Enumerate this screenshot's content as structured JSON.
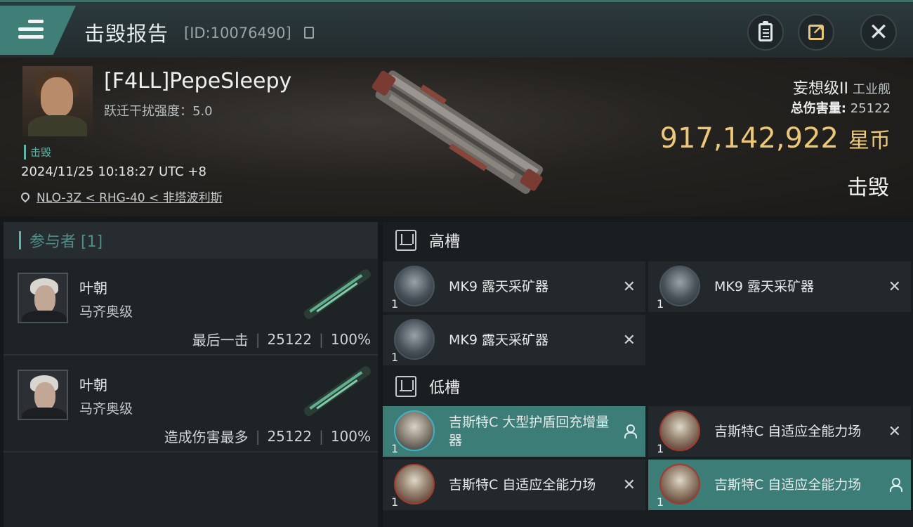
{
  "header": {
    "title": "击毁报告",
    "report_id": "[ID:10076490]"
  },
  "victim": {
    "pilot": "[F4LL]PepeSleepy",
    "scram_strength": "跃迁干扰强度：5.0",
    "tag": "击毁",
    "time": "2024/11/25 10:18:27 UTC +8",
    "location": "NLO-3Z < RHG-40 < 非塔波利斯",
    "ship": "妄想级II",
    "ship_class": "工业舰",
    "total_damage_label": "总伤害量:",
    "total_damage": "25122",
    "isk_value": "917,142,922",
    "isk_unit": "星币",
    "status": "击毁"
  },
  "participants": {
    "header": "参与者 [1]",
    "rows": [
      {
        "name": "叶朝",
        "ship": "马齐奥级",
        "label": "最后一击",
        "damage": "25122",
        "percent": "100%"
      },
      {
        "name": "叶朝",
        "ship": "马齐奥级",
        "label": "造成伤害最多",
        "damage": "25122",
        "percent": "100%"
      }
    ]
  },
  "fitting": {
    "high_slot_label": "高槽",
    "low_slot_label": "低槽",
    "high": [
      {
        "name": "MK9 露天采矿器",
        "qty": "1",
        "state": "destroyed"
      },
      {
        "name": "MK9 露天采矿器",
        "qty": "1",
        "state": "destroyed"
      },
      {
        "name": "MK9 露天采矿器",
        "qty": "1",
        "state": "destroyed"
      }
    ],
    "low": [
      {
        "name": "吉斯特C 大型护盾回充增量器",
        "qty": "1",
        "state": "dropped"
      },
      {
        "name": "吉斯特C 自适应全能力场",
        "qty": "1",
        "state": "destroyed"
      },
      {
        "name": "吉斯特C 自适应全能力场",
        "qty": "1",
        "state": "destroyed"
      },
      {
        "name": "吉斯特C 自适应全能力场",
        "qty": "1",
        "state": "dropped"
      }
    ]
  },
  "colors": {
    "accent": "#3d7d77",
    "isk": "#ecc878"
  }
}
